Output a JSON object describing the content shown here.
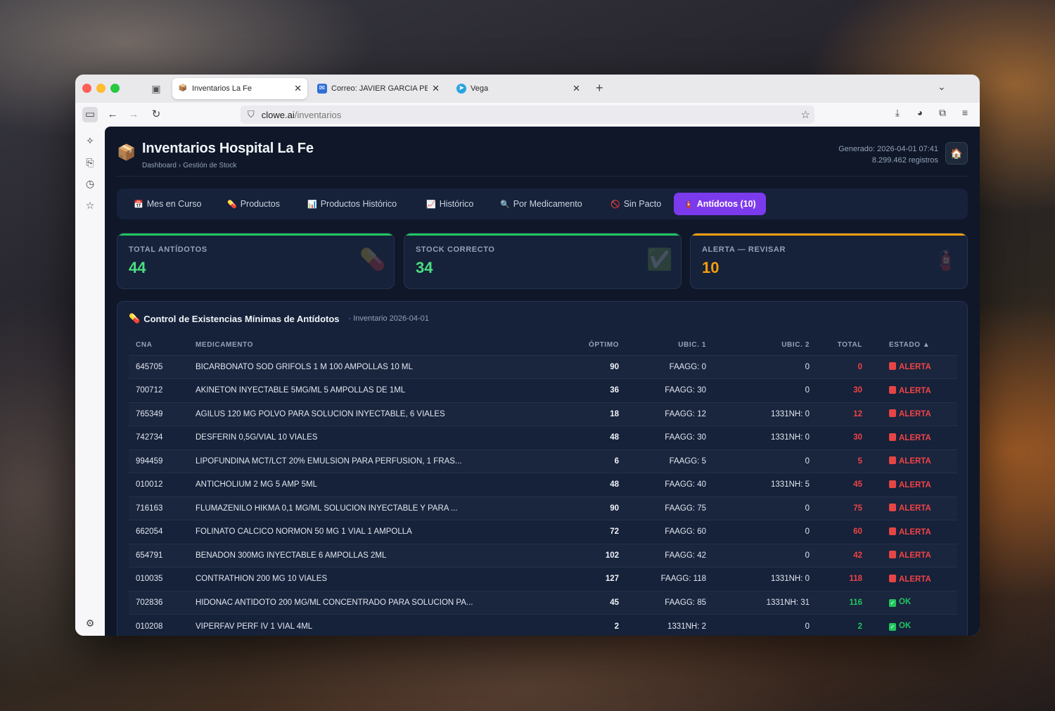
{
  "browser": {
    "tabs": [
      {
        "title": "Inventarios La Fe",
        "icon": "package-icon",
        "active": true
      },
      {
        "title": "Correo: JAVIER GARCIA PELLICER",
        "icon": "mail-icon",
        "active": false
      },
      {
        "title": "Vega",
        "icon": "telegram-icon",
        "active": false
      }
    ],
    "url": {
      "host": "clowe.ai",
      "path": "/inventarios"
    }
  },
  "app": {
    "title": "Inventarios Hospital La Fe",
    "breadcrumb": [
      "Dashboard",
      "Gestión de Stock"
    ],
    "breadcrumb_sep": "›",
    "generated": "Generado: 2026-04-01 07:41",
    "records": "8.299.462 registros"
  },
  "nav": [
    {
      "label": "Mes en Curso",
      "icon": "📅",
      "active": false
    },
    {
      "label": "Productos",
      "icon": "💊",
      "active": false
    },
    {
      "label": "Productos Histórico",
      "icon": "📊",
      "active": false
    },
    {
      "label": "Histórico",
      "icon": "📈",
      "active": false
    },
    {
      "label": "Por Medicamento",
      "icon": "🔍",
      "active": false
    },
    {
      "label": "Sin Pacto",
      "icon": "🚫",
      "active": false
    },
    {
      "label": "Antídotos (10)",
      "icon": "🧯",
      "active": true
    }
  ],
  "stats": [
    {
      "label": "TOTAL ANTÍDOTOS",
      "value": "44",
      "color": "#4ade80",
      "bar": "#22c55e",
      "icon": "💊"
    },
    {
      "label": "STOCK CORRECTO",
      "value": "34",
      "color": "#4ade80",
      "bar": "#22c55e",
      "icon": "✅"
    },
    {
      "label": "ALERTA — REVISAR",
      "value": "10",
      "color": "#f59e0b",
      "bar": "#f59e0b",
      "icon": "🧯"
    }
  ],
  "table": {
    "title": "Control de Existencias Mínimas de Antídotos",
    "subtitle": "· Inventario 2026-04-01",
    "columns": [
      "CNA",
      "MEDICAMENTO",
      "ÓPTIMO",
      "UBIC. 1",
      "UBIC. 2",
      "TOTAL",
      "ESTADO ▲"
    ],
    "rows": [
      {
        "cna": "645705",
        "med": "BICARBONATO SOD GRIFOLS 1 M 100 AMPOLLAS 10 ML",
        "opt": "90",
        "u1": "FAAGG: 0",
        "u2": "0",
        "total": "0",
        "estado": "ALERTA"
      },
      {
        "cna": "700712",
        "med": "AKINETON INYECTABLE 5MG/ML 5 AMPOLLAS DE 1ML",
        "opt": "36",
        "u1": "FAAGG: 30",
        "u2": "0",
        "total": "30",
        "estado": "ALERTA"
      },
      {
        "cna": "765349",
        "med": "AGILUS 120 MG POLVO PARA SOLUCION INYECTABLE, 6 VIALES",
        "opt": "18",
        "u1": "FAAGG: 12",
        "u2": "1331NH: 0",
        "total": "12",
        "estado": "ALERTA"
      },
      {
        "cna": "742734",
        "med": "DESFERIN 0,5G/VIAL 10 VIALES",
        "opt": "48",
        "u1": "FAAGG: 30",
        "u2": "1331NH: 0",
        "total": "30",
        "estado": "ALERTA"
      },
      {
        "cna": "994459",
        "med": "LIPOFUNDINA MCT/LCT 20% EMULSION PARA PERFUSION, 1 FRAS...",
        "opt": "6",
        "u1": "FAAGG: 5",
        "u2": "0",
        "total": "5",
        "estado": "ALERTA"
      },
      {
        "cna": "010012",
        "med": "ANTICHOLIUM 2 MG 5 AMP 5ML",
        "opt": "48",
        "u1": "FAAGG: 40",
        "u2": "1331NH: 5",
        "total": "45",
        "estado": "ALERTA"
      },
      {
        "cna": "716163",
        "med": "FLUMAZENILO HIKMA 0,1 MG/ML SOLUCION INYECTABLE Y PARA ...",
        "opt": "90",
        "u1": "FAAGG: 75",
        "u2": "0",
        "total": "75",
        "estado": "ALERTA"
      },
      {
        "cna": "662054",
        "med": "FOLINATO CALCICO NORMON 50 MG 1 VIAL 1 AMPOLLA",
        "opt": "72",
        "u1": "FAAGG: 60",
        "u2": "0",
        "total": "60",
        "estado": "ALERTA"
      },
      {
        "cna": "654791",
        "med": "BENADON 300MG INYECTABLE 6 AMPOLLAS 2ML",
        "opt": "102",
        "u1": "FAAGG: 42",
        "u2": "0",
        "total": "42",
        "estado": "ALERTA"
      },
      {
        "cna": "010035",
        "med": "CONTRATHION 200 MG 10 VIALES",
        "opt": "127",
        "u1": "FAAGG: 118",
        "u2": "1331NH: 0",
        "total": "118",
        "estado": "ALERTA"
      },
      {
        "cna": "702836",
        "med": "HIDONAC ANTIDOTO 200 MG/ML CONCENTRADO PARA SOLUCION PA...",
        "opt": "45",
        "u1": "FAAGG: 85",
        "u2": "1331NH: 31",
        "total": "116",
        "estado": "OK"
      },
      {
        "cna": "010208",
        "med": "VIPERFAV PERF IV 1 VIAL 4ML",
        "opt": "2",
        "u1": "1331NH: 2",
        "u2": "0",
        "total": "2",
        "estado": "OK"
      }
    ]
  }
}
